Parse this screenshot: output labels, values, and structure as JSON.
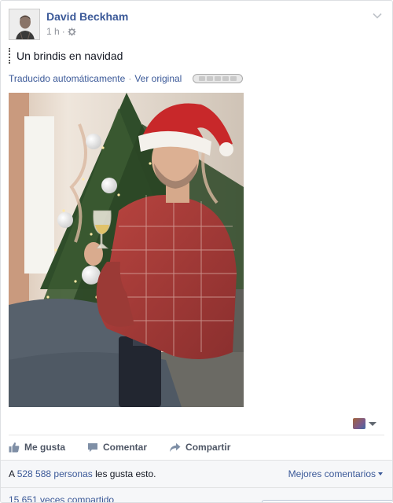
{
  "post": {
    "author": "David Beckham",
    "time": "1 h",
    "time_sep": "·",
    "text": "Un brindis en navidad",
    "translation": {
      "auto_label": "Traducido automáticamente",
      "sep": "·",
      "original_label": "Ver original"
    },
    "photo_alt": "Christmas tree photo with man in Santa hat toasting"
  },
  "icons": {
    "avatar": "profile-picture",
    "privacy": "gear-icon",
    "menu": "chevron-down-icon",
    "like": "thumbs-up-icon",
    "comment": "speech-bubble-icon",
    "share": "share-arrow-icon",
    "audience": "audience-selector"
  },
  "actions": {
    "like_label": "Me gusta",
    "comment_label": "Comentar",
    "share_label": "Compartir"
  },
  "stats": {
    "likes_prefix": "A",
    "likes_count": "528 588 personas",
    "likes_suffix": "les gusta esto.",
    "top_comments": "Mejores comentarios",
    "shares": "15 651 veces compartido"
  },
  "colors": {
    "link": "#3b5998",
    "action_text": "#4e5665",
    "meta_text": "#90949c",
    "footer_bg": "#f6f7f9"
  }
}
